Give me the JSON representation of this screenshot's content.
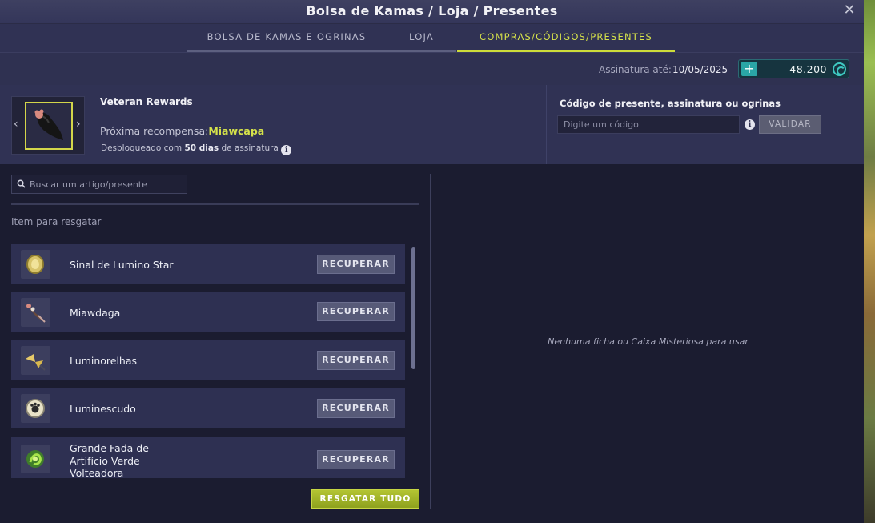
{
  "window": {
    "title": "Bolsa de Kamas / Loja / Presentes"
  },
  "tabs": [
    {
      "label": "BOLSA DE KAMAS E OGRINAS"
    },
    {
      "label": "LOJA"
    },
    {
      "label": "COMPRAS/CÓDIGOS/PRESENTES",
      "active": true
    }
  ],
  "subscription": {
    "label": "Assinatura até:",
    "date": "10/05/2025",
    "ogrines": "48.200"
  },
  "veteran": {
    "title": "Veteran Rewards",
    "next_label": "Próxima recompensa:",
    "next_name": "Miawcapa",
    "unlock_prefix": "Desbloqueado com",
    "unlock_days": "50 dias",
    "unlock_suffix": "de assinatura"
  },
  "code": {
    "title": "Código de presente, assinatura ou ogrinas",
    "placeholder": "Digite um código",
    "validate_label": "VALIDAR"
  },
  "search": {
    "placeholder": "Buscar um artigo/presente"
  },
  "items_section_label": "Item para resgatar",
  "items": [
    {
      "name": "Sinal de Lumino Star",
      "button": "RECUPERAR",
      "icon": "coin-icon"
    },
    {
      "name": "Miawdaga",
      "button": "RECUPERAR",
      "icon": "dagger-icon"
    },
    {
      "name": "Luminorelhas",
      "button": "RECUPERAR",
      "icon": "ears-icon"
    },
    {
      "name": "Luminescudo",
      "button": "RECUPERAR",
      "icon": "shield-icon"
    },
    {
      "name": "Grande Fada de Artifício Verde Volteadora",
      "button": "RECUPERAR",
      "icon": "firework-icon"
    }
  ],
  "redeem_all_label": "RESGATAR TUDO",
  "empty_message": "Nenhuma ficha ou Caixa Misteriosa para usar",
  "colors": {
    "accent": "#cddc39",
    "panel": "#2e3052",
    "background": "#1b1c30",
    "currency": "#3ec9c1"
  }
}
